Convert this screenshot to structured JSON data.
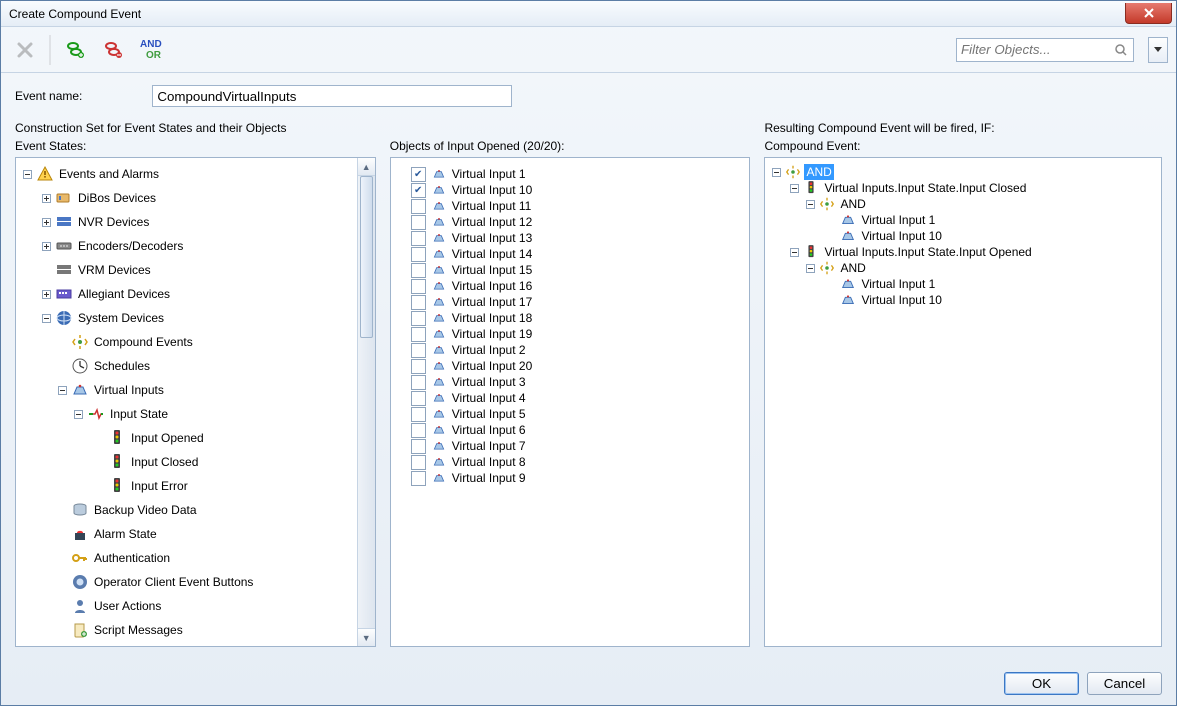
{
  "window": {
    "title": "Create Compound Event"
  },
  "toolbar": {
    "andor_and": "AND",
    "andor_or": "OR",
    "filter_placeholder": "Filter Objects..."
  },
  "eventName": {
    "label": "Event name:",
    "value": "CompoundVirtualInputs"
  },
  "constructionSetLabel": "Construction Set for Event States and their Objects",
  "eventStates": {
    "header": "Event States:",
    "root": "Events and Alarms",
    "dibos": "DiBos Devices",
    "nvr": "NVR Devices",
    "encdec": "Encoders/Decoders",
    "vrm": "VRM Devices",
    "allegiant": "Allegiant Devices",
    "system": "System Devices",
    "compound": "Compound Events",
    "schedules": "Schedules",
    "vinputs": "Virtual Inputs",
    "inputState": "Input State",
    "inputOpened": "Input Opened",
    "inputClosed": "Input Closed",
    "inputError": "Input Error",
    "backup": "Backup Video Data",
    "alarmState": "Alarm State",
    "auth": "Authentication",
    "ocbuttons": "Operator Client Event Buttons",
    "userActions": "User Actions",
    "scriptMsg": "Script Messages"
  },
  "objects": {
    "header": "Objects of Input Opened (20/20):",
    "items": [
      {
        "label": "Virtual Input 1",
        "checked": true
      },
      {
        "label": "Virtual Input 10",
        "checked": true
      },
      {
        "label": "Virtual Input 11",
        "checked": false
      },
      {
        "label": "Virtual Input 12",
        "checked": false
      },
      {
        "label": "Virtual Input 13",
        "checked": false
      },
      {
        "label": "Virtual Input 14",
        "checked": false
      },
      {
        "label": "Virtual Input 15",
        "checked": false
      },
      {
        "label": "Virtual Input 16",
        "checked": false
      },
      {
        "label": "Virtual Input 17",
        "checked": false
      },
      {
        "label": "Virtual Input 18",
        "checked": false
      },
      {
        "label": "Virtual Input 19",
        "checked": false
      },
      {
        "label": "Virtual Input 2",
        "checked": false
      },
      {
        "label": "Virtual Input 20",
        "checked": false
      },
      {
        "label": "Virtual Input 3",
        "checked": false
      },
      {
        "label": "Virtual Input 4",
        "checked": false
      },
      {
        "label": "Virtual Input 5",
        "checked": false
      },
      {
        "label": "Virtual Input 6",
        "checked": false
      },
      {
        "label": "Virtual Input 7",
        "checked": false
      },
      {
        "label": "Virtual Input 8",
        "checked": false
      },
      {
        "label": "Virtual Input 9",
        "checked": false
      }
    ]
  },
  "result": {
    "description": "Resulting Compound Event will be fired, IF:",
    "header": "Compound Event:",
    "rootAnd": "AND",
    "closedPath": "Virtual Inputs.Input State.Input Closed",
    "openedPath": "Virtual Inputs.Input State.Input Opened",
    "and": "AND",
    "vin1": "Virtual Input 1",
    "vin10": "Virtual Input 10"
  },
  "buttons": {
    "ok": "OK",
    "cancel": "Cancel"
  }
}
